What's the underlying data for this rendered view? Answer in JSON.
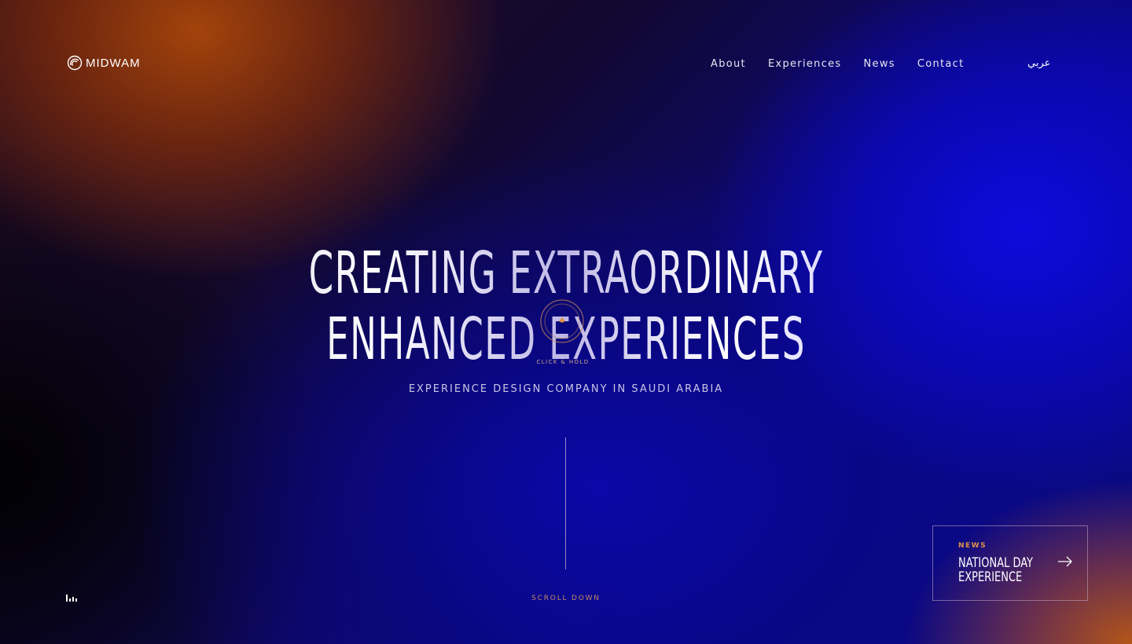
{
  "brand": {
    "name": "MIDWAM"
  },
  "nav": {
    "items": [
      {
        "label": "About"
      },
      {
        "label": "Experiences"
      },
      {
        "label": "News"
      },
      {
        "label": "Contact"
      }
    ],
    "language": "عربي"
  },
  "hero": {
    "line1": "CREATING EXTRAORDINARY",
    "line2": "ENHANCED EXPERIENCES",
    "subtitle": "EXPERIENCE DESIGN COMPANY IN SAUDI ARABIA",
    "cursor_hint": "CLICK & HOLD"
  },
  "scroll": {
    "label": "SCROLL DOWN"
  },
  "news_card": {
    "tag": "NEWS",
    "title": "NATIONAL DAY EXPERIENCE"
  },
  "icons": {
    "logo": "midwam-logo-icon",
    "sound": "sound-bars-icon",
    "arrow": "arrow-right-icon",
    "cursor": "cursor-ring-icon"
  },
  "colors": {
    "accent_orange": "#e0924a",
    "deep_blue": "#0a0890",
    "text": "#ffffff"
  }
}
